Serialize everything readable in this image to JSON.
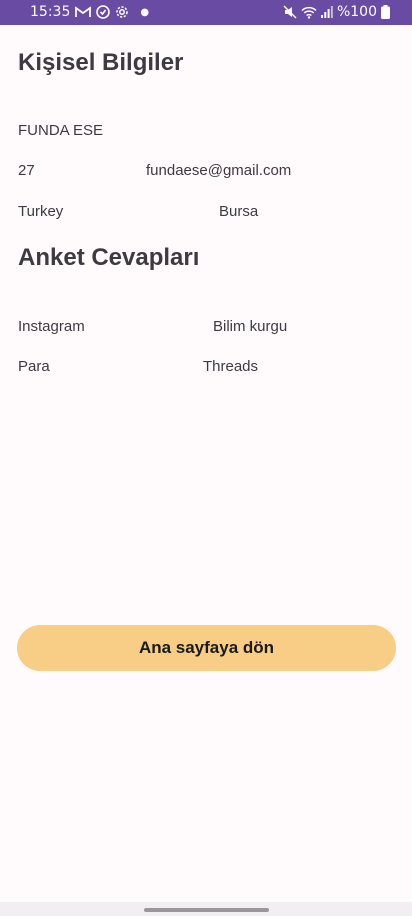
{
  "status_bar": {
    "time": "15:35",
    "battery_text": "%100",
    "background_color": "#6a4ba3",
    "icons": [
      "gmail-icon",
      "shield-icon",
      "settings-gear-icon",
      "notification-dot",
      "mute-icon",
      "wifi-icon",
      "signal-icon",
      "battery-icon"
    ]
  },
  "personal_info": {
    "title": "Kişisel Bilgiler",
    "name": "FUNDA ESE",
    "age": "27",
    "email": "fundaese@gmail.com",
    "country": "Turkey",
    "city": "Bursa"
  },
  "survey_answers": {
    "title": "Anket Cevapları",
    "answer_1": "Instagram",
    "answer_2": "Bilim kurgu",
    "answer_3": "Para",
    "answer_4": "Threads"
  },
  "actions": {
    "home_button_label": "Ana sayfaya dön",
    "home_button_color": "#f8cd85"
  }
}
